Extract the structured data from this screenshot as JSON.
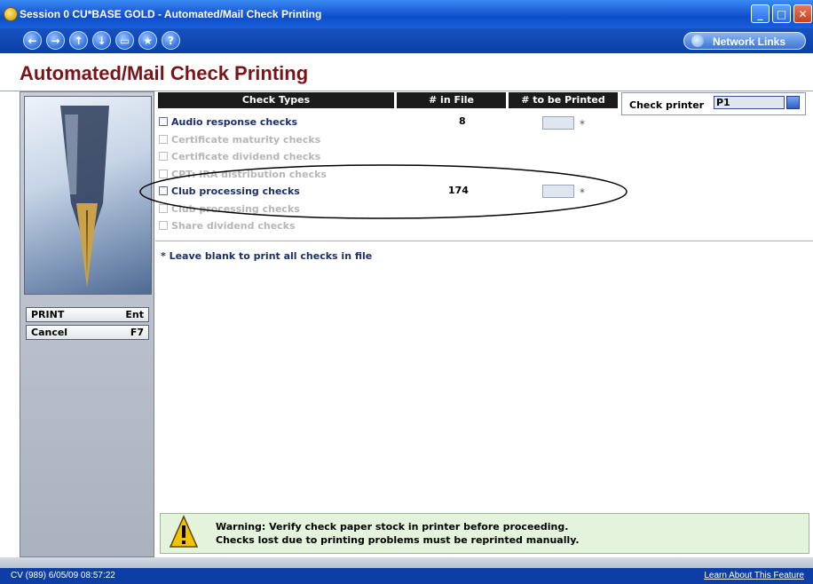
{
  "window": {
    "title": "Session 0 CU*BASE GOLD - Automated/Mail Check Printing"
  },
  "nav": {
    "buttons": [
      "back-icon",
      "forward-icon",
      "up-icon",
      "down-icon",
      "print-icon",
      "favorite-icon",
      "help-icon"
    ],
    "network_links": "Network Links"
  },
  "page": {
    "title": "Automated/Mail Check Printing"
  },
  "columns": {
    "check_types": "Check Types",
    "in_file": "# in File",
    "to_be_printed": "# to be Printed"
  },
  "printer": {
    "label": "Check printer",
    "value": "P1"
  },
  "rows": [
    {
      "label": "Audio response checks",
      "count": "8",
      "enabled": true
    },
    {
      "label": "Certificate maturity checks",
      "count": "",
      "enabled": false
    },
    {
      "label": "Certificate dividend checks",
      "count": "",
      "enabled": false
    },
    {
      "label": "CPT: IRA distribution checks",
      "count": "",
      "enabled": false
    },
    {
      "label": "Club processing checks",
      "count": "174",
      "enabled": true
    },
    {
      "label": "Club processing checks",
      "count": "",
      "enabled": false
    },
    {
      "label": "Share dividend checks",
      "count": "",
      "enabled": false
    }
  ],
  "star": "*",
  "note": "* Leave blank to print all checks in file",
  "commands": [
    {
      "label": "PRINT",
      "key": "Ent"
    },
    {
      "label": "Cancel",
      "key": "F7"
    }
  ],
  "warning": {
    "line1": "Warning:  Verify check paper stock in printer before proceeding.",
    "line2": "Checks lost due to printing problems must be reprinted manually."
  },
  "status": {
    "left": "CV (989) 6/05/09 08:57:22",
    "right": "Learn About This Feature"
  }
}
